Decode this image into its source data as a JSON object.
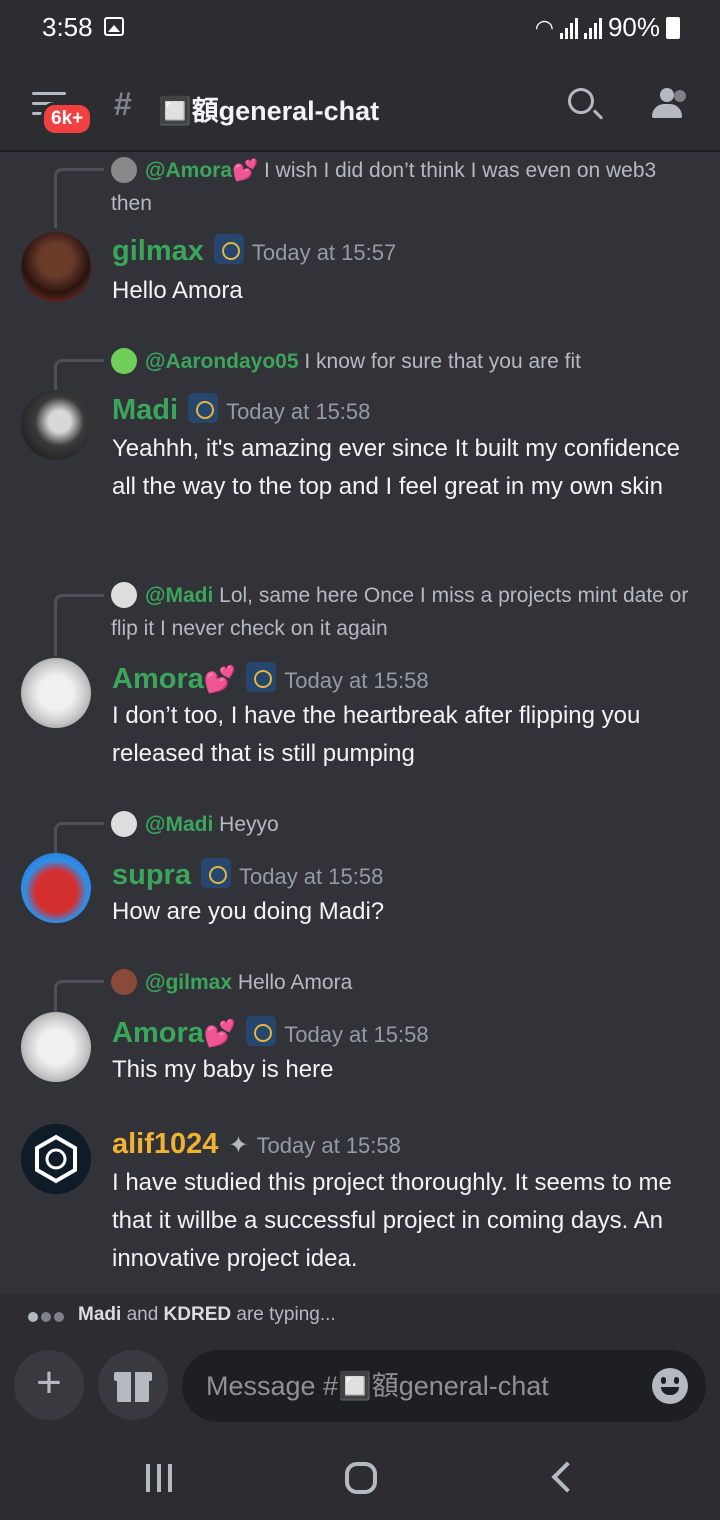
{
  "status": {
    "time": "3:58",
    "battery": "90%"
  },
  "header": {
    "badge": "6k+",
    "channel": "🔲額general-chat"
  },
  "messages": [
    {
      "reply_mention": "@Amora💕",
      "reply_text": "I wish I did don’t think I was even on web3 then",
      "author": "gilmax",
      "time": "Today at 15:57",
      "text": "Hello Amora"
    },
    {
      "reply_mention": "@Aarondayo05",
      "reply_text": "I know for sure that you are fit",
      "author": "Madi",
      "time": "Today at 15:58",
      "text": "Yeahhh, it's amazing ever since It built my confidence all the way to the top and I feel great in my own skin"
    },
    {
      "reply_mention": "@Madi",
      "reply_text": "Lol, same here Once I miss a projects mint date or flip it I never check on it again",
      "author": "Amora",
      "time": "Today at 15:58",
      "text": "I don’t too, I have the heartbreak after flipping you released that is still pumping"
    },
    {
      "reply_mention": "@Madi",
      "reply_text": "Heyyo",
      "author": "supra",
      "time": "Today at 15:58",
      "text": "How are you doing Madi?"
    },
    {
      "reply_mention": "@gilmax",
      "reply_text": "Hello Amora",
      "author": "Amora",
      "time": "Today at 15:58",
      "text": "This my baby is here"
    },
    {
      "author": "alif1024",
      "time": "Today at 15:58",
      "text": "I have studied this project thoroughly. It seems to me that it willbe a successful project in coming days. An innovative project idea."
    }
  ],
  "typing": {
    "user1": "Madi",
    "and": "and",
    "user2": "KDRED",
    "suffix": "are typing..."
  },
  "composer": {
    "placeholder": "Message #🔲額general-chat"
  },
  "colors": {
    "background": "#313338",
    "header": "#2b2d31",
    "name_green": "#3ba55c",
    "name_gold": "#f0b232",
    "badge": "#f23f42"
  },
  "icons": [
    "menu-icon",
    "hash-lock-icon",
    "search-icon",
    "members-icon",
    "passport-icon",
    "astronaut-icon",
    "plus-icon",
    "gift-icon",
    "emoji-icon"
  ]
}
